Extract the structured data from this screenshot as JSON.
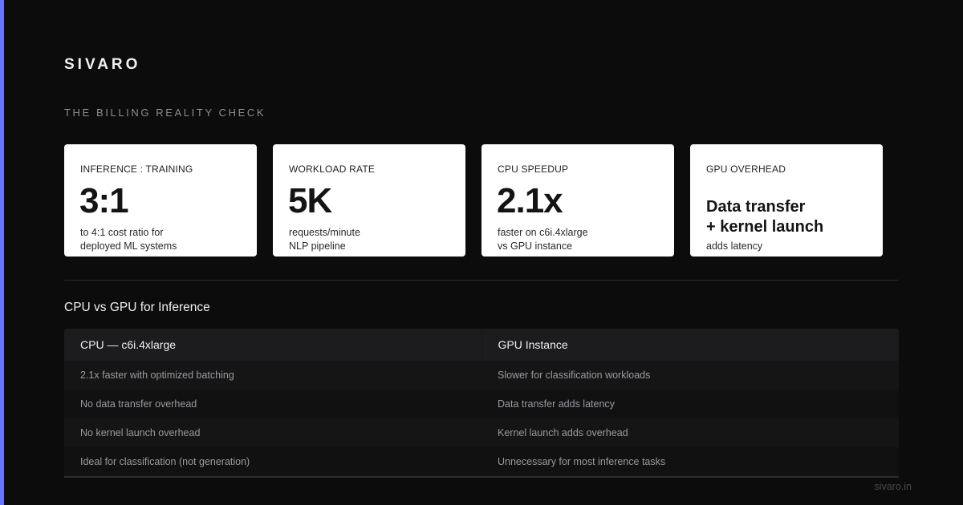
{
  "brand": "SIVARO",
  "subtitle": "THE BILLING REALITY CHECK",
  "colors": {
    "background": "#0c0c0c",
    "accent": "#6a73ff",
    "card": "#ffffff"
  },
  "cards": [
    {
      "label": "INFERENCE : TRAINING",
      "value": "3:1",
      "desc": [
        "to 4:1 cost ratio for",
        "deployed ML systems"
      ]
    },
    {
      "label": "WORKLOAD RATE",
      "value": "5K",
      "desc": [
        "requests/minute",
        "NLP pipeline"
      ]
    },
    {
      "label": "CPU SPEEDUP",
      "value": "2.1x",
      "desc": [
        "faster on c6i.4xlarge",
        "vs GPU instance"
      ]
    },
    {
      "label": "GPU OVERHEAD",
      "value_lines": [
        "Data transfer",
        "+ kernel launch"
      ],
      "desc": [
        "adds latency"
      ]
    }
  ],
  "comparison": {
    "title": "CPU vs GPU for Inference",
    "headers": [
      "CPU — c6i.4xlarge",
      "GPU Instance"
    ],
    "rows": [
      [
        "2.1x faster with optimized batching",
        "Slower for classification workloads"
      ],
      [
        "No data transfer overhead",
        "Data transfer adds latency"
      ],
      [
        "No kernel launch overhead",
        "Kernel launch adds overhead"
      ],
      [
        "Ideal for classification (not generation)",
        "Unnecessary for most inference tasks"
      ]
    ]
  },
  "footer": {
    "url": "sivaro.in"
  }
}
